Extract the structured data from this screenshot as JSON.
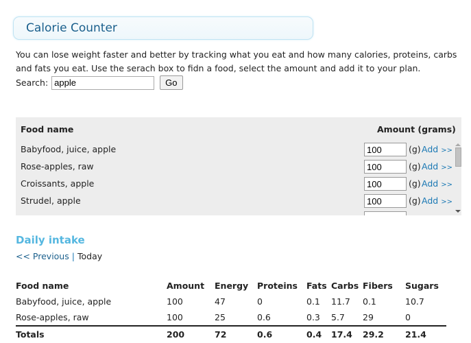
{
  "header": {
    "title": "Calorie Counter"
  },
  "intro": "You can lose weight faster and better by tracking what you eat and how many calories, proteins, carbs and fats you eat. Use the serach box to fidn a food, select the amount and add it to your plan.",
  "search": {
    "label": "Search:",
    "value": "apple",
    "button": "Go"
  },
  "results": {
    "col_name": "Food name",
    "col_amount": "Amount (grams)",
    "unit": "(g)",
    "add_label": "Add",
    "add_arrow": ">>",
    "rows": [
      {
        "name": "Babyfood, juice, apple",
        "amount": "100"
      },
      {
        "name": "Rose-apples, raw",
        "amount": "100"
      },
      {
        "name": "Croissants, apple",
        "amount": "100"
      },
      {
        "name": "Strudel, apple",
        "amount": "100"
      },
      {
        "name": "",
        "amount": ""
      }
    ]
  },
  "daily": {
    "title": "Daily intake",
    "prev": "<< Previous",
    "sep": "|",
    "current": "Today",
    "headers": [
      "Food name",
      "Amount",
      "Energy",
      "Proteins",
      "Fats",
      "Carbs",
      "Fibers",
      "Sugars"
    ],
    "rows": [
      [
        "Babyfood, juice, apple",
        "100",
        "47",
        "0",
        "0.1",
        "11.7",
        "0.1",
        "10.7"
      ],
      [
        "Rose-apples, raw",
        "100",
        "25",
        "0.6",
        "0.3",
        "5.7",
        "29",
        "0"
      ]
    ],
    "totals": [
      "Totals",
      "200",
      "72",
      "0.6",
      "0.4",
      "17.4",
      "29.2",
      "21.4"
    ]
  }
}
